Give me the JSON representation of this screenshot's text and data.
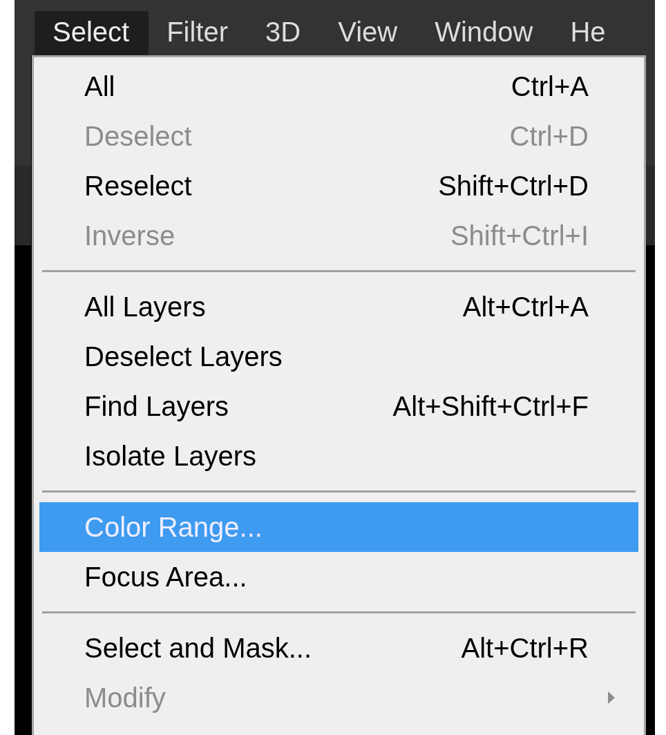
{
  "menu_bar": [
    {
      "label": "Select",
      "selected": true
    },
    {
      "label": "Filter",
      "selected": false
    },
    {
      "label": "3D",
      "selected": false
    },
    {
      "label": "View",
      "selected": false
    },
    {
      "label": "Window",
      "selected": false
    },
    {
      "label": "He",
      "selected": false
    }
  ],
  "menu": {
    "items": [
      {
        "kind": "item",
        "label": "All",
        "shortcut": "Ctrl+A",
        "disabled": false,
        "selected": false
      },
      {
        "kind": "item",
        "label": "Deselect",
        "shortcut": "Ctrl+D",
        "disabled": true,
        "selected": false
      },
      {
        "kind": "item",
        "label": "Reselect",
        "shortcut": "Shift+Ctrl+D",
        "disabled": false,
        "selected": false
      },
      {
        "kind": "item",
        "label": "Inverse",
        "shortcut": "Shift+Ctrl+I",
        "disabled": true,
        "selected": false
      },
      {
        "kind": "separator"
      },
      {
        "kind": "item",
        "label": "All Layers",
        "shortcut": "Alt+Ctrl+A",
        "disabled": false,
        "selected": false
      },
      {
        "kind": "item",
        "label": "Deselect Layers",
        "disabled": false,
        "selected": false
      },
      {
        "kind": "item",
        "label": "Find Layers",
        "shortcut": "Alt+Shift+Ctrl+F",
        "disabled": false,
        "selected": false
      },
      {
        "kind": "item",
        "label": "Isolate Layers",
        "disabled": false,
        "selected": false
      },
      {
        "kind": "separator"
      },
      {
        "kind": "item",
        "label": "Color Range...",
        "disabled": false,
        "selected": true
      },
      {
        "kind": "item",
        "label": "Focus Area...",
        "disabled": false,
        "selected": false
      },
      {
        "kind": "separator"
      },
      {
        "kind": "item",
        "label": "Select and Mask...",
        "shortcut": "Alt+Ctrl+R",
        "disabled": false,
        "selected": false
      },
      {
        "kind": "submenu",
        "label": "Modify",
        "disabled": true,
        "selected": false
      }
    ]
  }
}
